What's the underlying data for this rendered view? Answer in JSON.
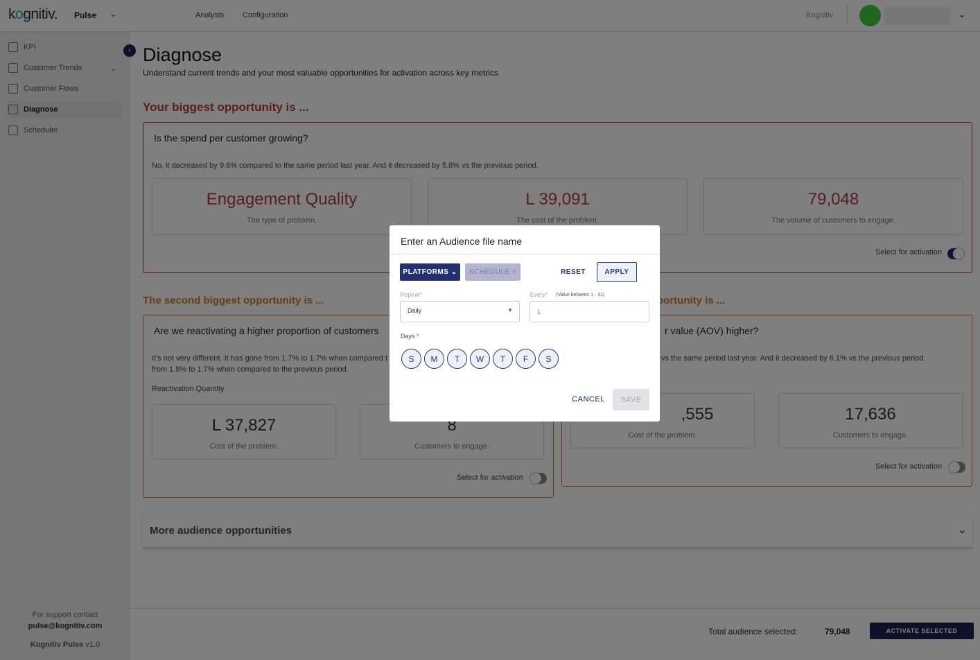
{
  "header": {
    "logo": "kognitiv",
    "product": "Pulse",
    "nav": [
      "Analysis",
      "Configuration"
    ],
    "org": "Kognitiv"
  },
  "sidebar": {
    "items": [
      {
        "label": "KPI",
        "icon": "grid-icon"
      },
      {
        "label": "Customer Trends",
        "icon": "chart-line-icon"
      },
      {
        "label": "Customer Flows",
        "icon": "flow-icon"
      },
      {
        "label": "Diagnose",
        "icon": "diagnose-icon"
      },
      {
        "label": "Scheduler",
        "icon": "calendar-icon"
      }
    ],
    "support": "For support contact",
    "email": "pulse@kognitiv.com",
    "version_name": "Kognitiv Pulse",
    "version": "v1.0"
  },
  "page": {
    "title": "Diagnose",
    "subtitle": "Understand current trends and your most valuable opportunities for activation across key metrics"
  },
  "opp1": {
    "heading": "Your biggest opportunity is ...",
    "question": "Is the spend per customer growing?",
    "text": "No, it decreased by 9.6% compared to the same period last year. And it decreased by 5.8% vs the previous period.",
    "stats": [
      {
        "value": "Engagement Quality",
        "label": "The type of problem."
      },
      {
        "value": "L 39,091",
        "label": "The cost of the problem."
      },
      {
        "value": "79,048",
        "label": "The volume of customers to engage."
      }
    ],
    "toggle_label": "Select for activation",
    "selected": true
  },
  "opp2": {
    "heading": "The second biggest opportunity is ...",
    "question": "Are we reactivating a higher proportion of customers",
    "text1": "It's not very different. It has gone from 1.7% to 1.7% when compared t",
    "text2": "from 1.8% to 1.7% when compared to the previous period.",
    "metric": "Reactivation Quantity",
    "stats": [
      {
        "value": "L 37,827",
        "label": "Cost of the problem."
      },
      {
        "value": "8",
        "label": "Customers to engage."
      }
    ],
    "toggle_label": "Select for activation",
    "selected": false
  },
  "opp3": {
    "heading": "portunity is ...",
    "question": "r value (AOV) higher?",
    "text": "vs the same period last year. And it decreased by 6.1% vs the previous period.",
    "stats": [
      {
        "value": ",555",
        "label": "Cost of the problem."
      },
      {
        "value": "17,636",
        "label": "Customers to engage."
      }
    ],
    "toggle_label": "Select for activation",
    "selected": false
  },
  "more": {
    "label": "More audience opportunities"
  },
  "footer": {
    "total_label": "Total audience selected:",
    "total": "79,048",
    "activate": "ACTIVATE SELECTED"
  },
  "modal": {
    "title": "Enter an Audience file name",
    "platforms": "PLATFORMS",
    "schedule": "SCHEDULE",
    "reset": "RESET",
    "apply": "APPLY",
    "repeat_label": "Repeat*",
    "repeat_value": "Daily",
    "every_label": "Every*",
    "every_hint": "(Value between 1 - 31)",
    "every_placeholder": "1",
    "days_label": "Days",
    "days": [
      "S",
      "M",
      "T",
      "W",
      "T",
      "F",
      "S"
    ],
    "cancel": "CANCEL",
    "save": "SAVE"
  },
  "colors": {
    "primary": "#1f2b6b",
    "red": "#b53a3a",
    "orange": "#c97a2a"
  }
}
